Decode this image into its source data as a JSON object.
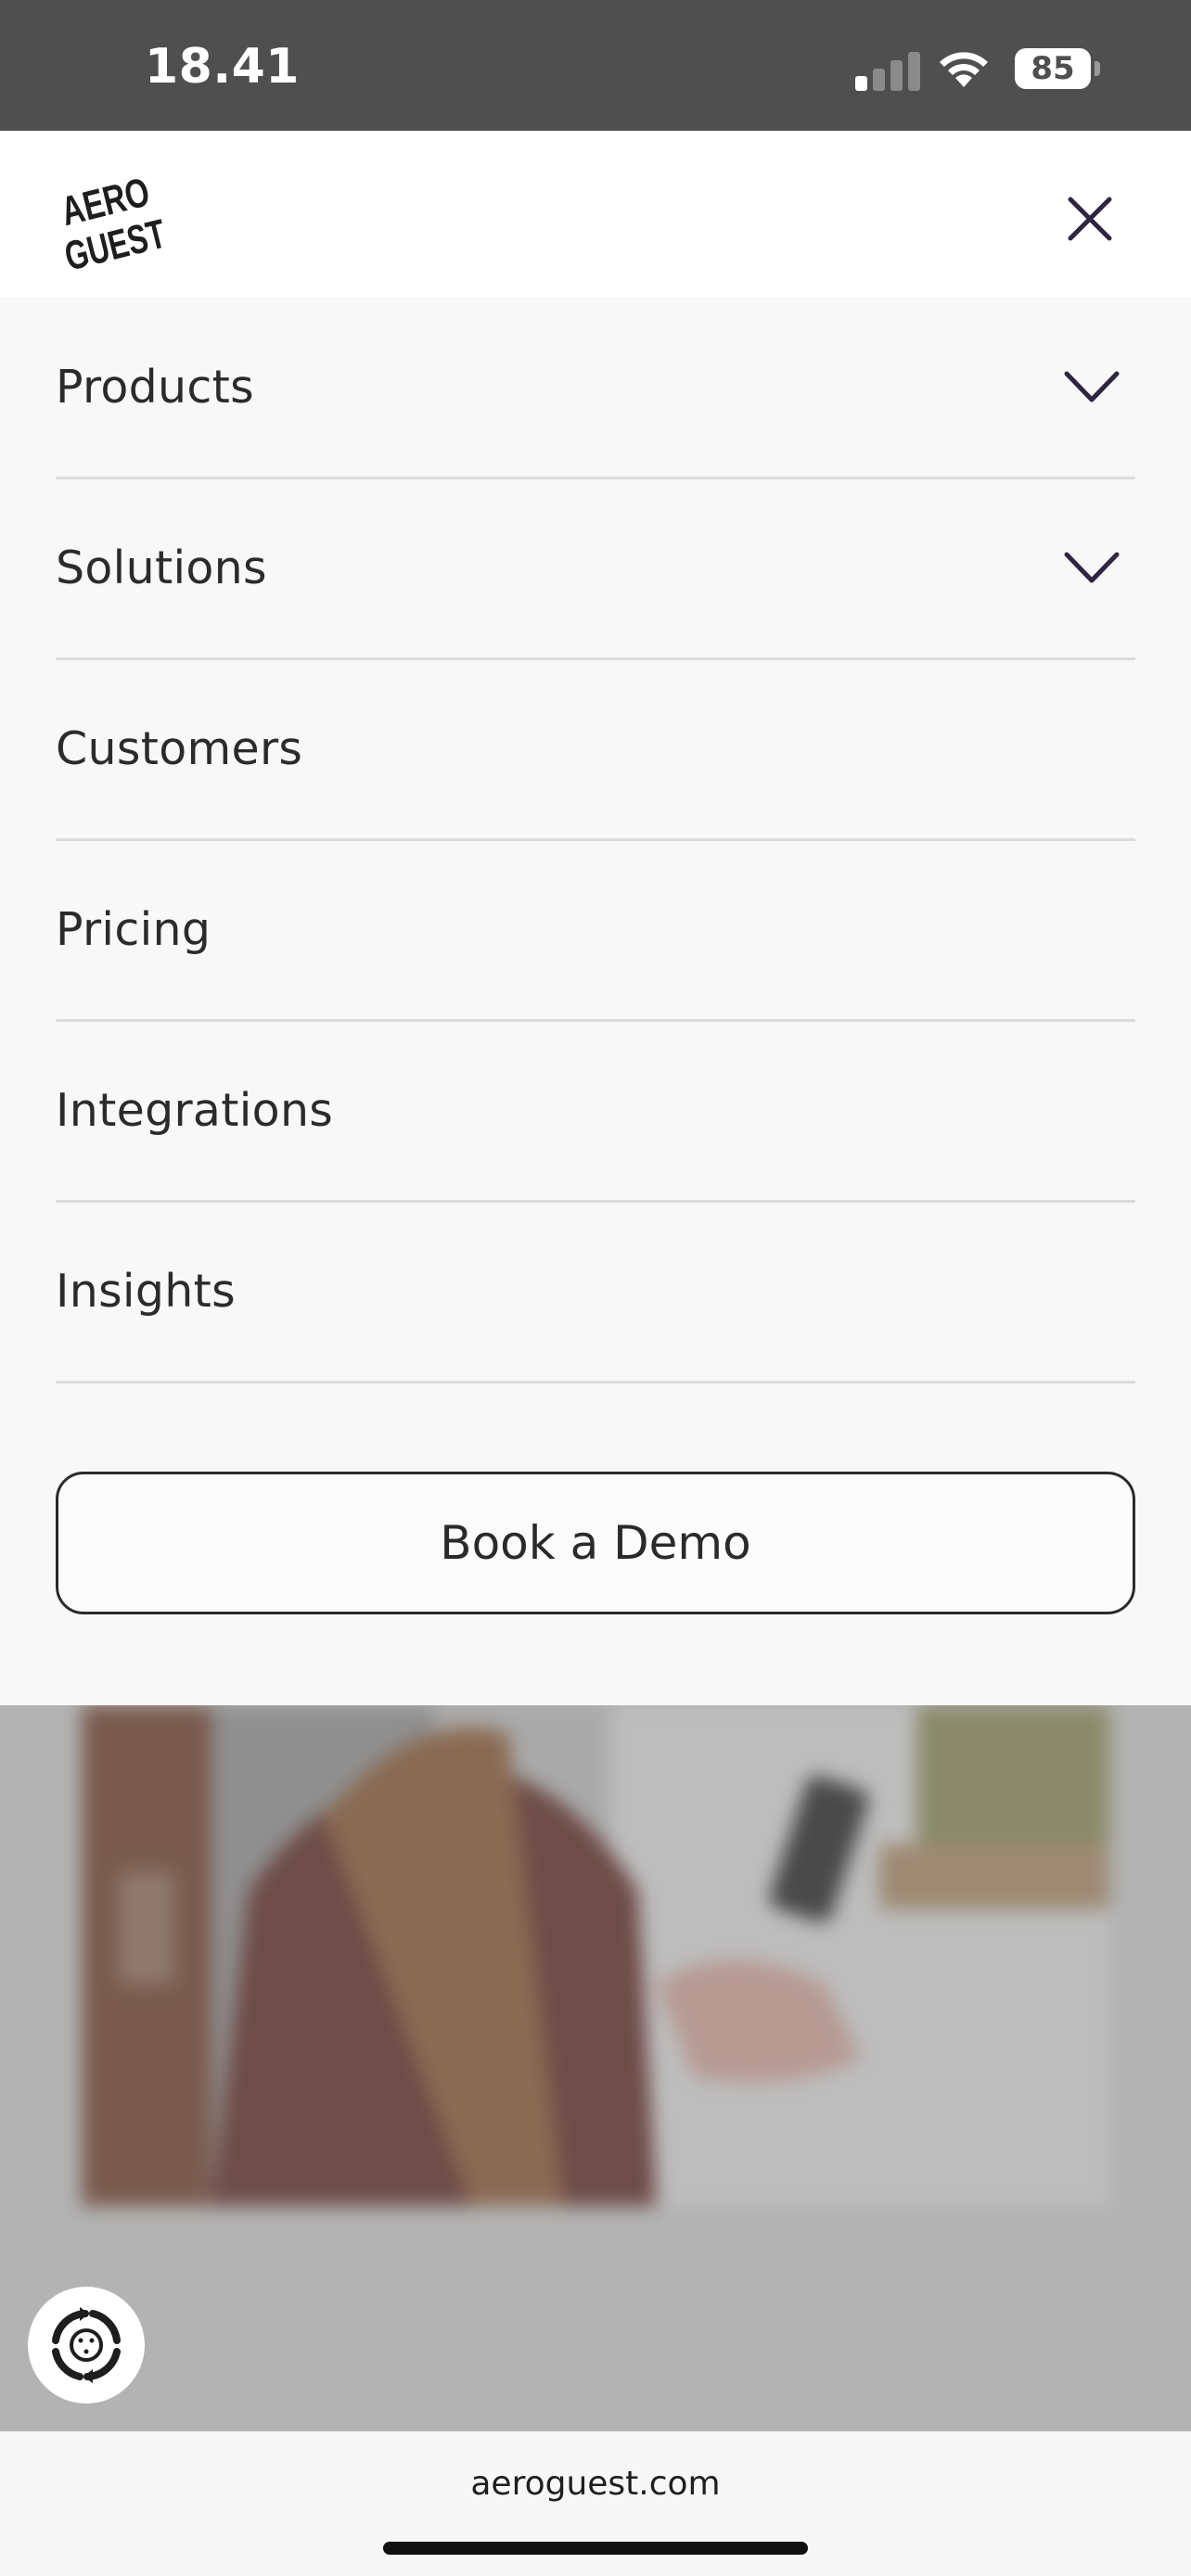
{
  "status_bar": {
    "time": "18.41",
    "battery": "85",
    "signal_bars_active": 1,
    "signal_bars_total": 4
  },
  "header": {
    "logo_text": [
      "AERO",
      "GUEST"
    ],
    "close_icon": "close-icon"
  },
  "menu": {
    "items": [
      {
        "label": "Products",
        "has_dropdown": true
      },
      {
        "label": "Solutions",
        "has_dropdown": true
      },
      {
        "label": "Customers",
        "has_dropdown": false
      },
      {
        "label": "Pricing",
        "has_dropdown": false
      },
      {
        "label": "Integrations",
        "has_dropdown": false
      },
      {
        "label": "Insights",
        "has_dropdown": false
      }
    ],
    "cta_label": "Book a Demo"
  },
  "page_behind": {
    "accessibility_icon": "accessibility-icon"
  },
  "browser": {
    "url": "aeroguest.com"
  },
  "colors": {
    "status_bar_bg": "#4f4f4f",
    "menu_bg": "#f8f8f8",
    "text": "#2b2b2b",
    "accent_icon": "#2e2540",
    "overlay": "#b3b3b3"
  }
}
